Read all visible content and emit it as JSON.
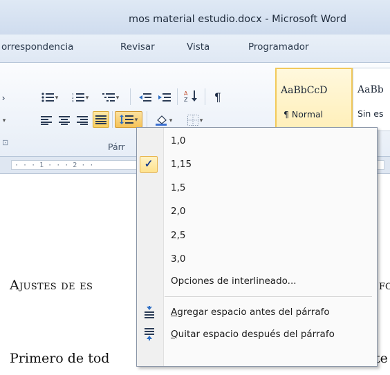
{
  "window": {
    "title": "mos material estudio.docx  -  Microsoft Word"
  },
  "tabs": [
    {
      "label": "orrespondencia"
    },
    {
      "label": "Revisar"
    },
    {
      "label": "Vista"
    },
    {
      "label": "Programador"
    }
  ],
  "ribbon": {
    "group_label": "Párr",
    "styles": [
      {
        "sample": "AaBbCcD",
        "name": "¶ Normal",
        "selected": true
      },
      {
        "sample": "AaBb",
        "name": "Sin es",
        "selected": false
      }
    ],
    "icons": [
      "bullets-icon",
      "numbering-icon",
      "multilevel-list-icon",
      "decrease-indent-icon",
      "increase-indent-icon",
      "sort-icon",
      "pilcrow-icon",
      "align-left-icon",
      "align-center-icon",
      "align-right-icon",
      "justify-icon",
      "line-spacing-icon",
      "shading-icon",
      "borders-icon"
    ]
  },
  "ruler": {
    "text": "·  ·  ·  1  ·  ·  ·  2  ·  ·"
  },
  "document": {
    "heading_visible": "Ajustes de es",
    "heading_tail": "fo",
    "para_visible": "Primero de tod",
    "para_tail": "te"
  },
  "menu": {
    "items": [
      {
        "label": "1,0",
        "checked": false
      },
      {
        "label": "1,15",
        "checked": true
      },
      {
        "label": "1,5",
        "checked": false
      },
      {
        "label": "2,0",
        "checked": false
      },
      {
        "label": "2,5",
        "checked": false
      },
      {
        "label": "3,0",
        "checked": false
      }
    ],
    "options_label": "Opciones de interlineado...",
    "add_before": {
      "accel": "A",
      "rest": "gregar espacio antes del párrafo"
    },
    "remove_after": {
      "accel": "Q",
      "rest": "uitar espacio después del párrafo"
    }
  }
}
